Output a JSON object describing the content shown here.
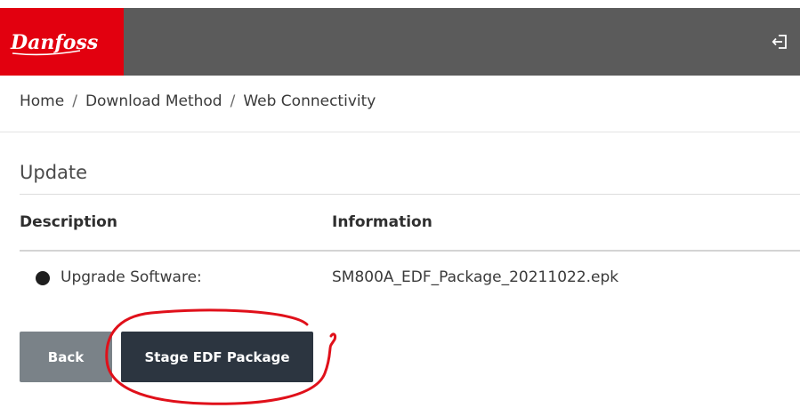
{
  "header": {
    "brand": "Danfoss",
    "brand_color": "#e2000f",
    "bar_color": "#5b5b5b",
    "logout_icon": "logout-icon"
  },
  "breadcrumb": {
    "items": [
      "Home",
      "Download Method",
      "Web Connectivity"
    ],
    "separator": "/"
  },
  "section": {
    "title": "Update"
  },
  "table": {
    "columns": [
      "Description",
      "Information"
    ],
    "rows": [
      {
        "description": "Upgrade Software:",
        "information": "SM800A_EDF_Package_20211022.epk"
      }
    ]
  },
  "actions": {
    "back_label": "Back",
    "stage_label": "Stage EDF Package"
  },
  "annotation": {
    "color": "#e0101a",
    "shape": "hand-drawn circle around stage button"
  }
}
